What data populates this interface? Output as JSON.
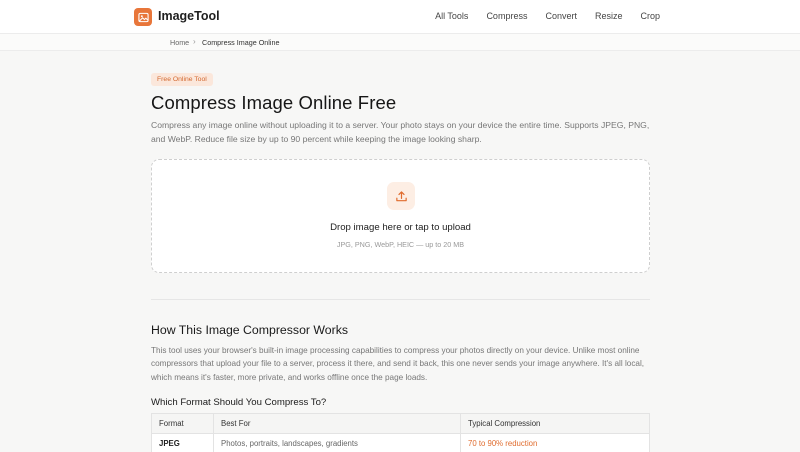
{
  "header": {
    "brand": "ImageTool",
    "nav": [
      "All Tools",
      "Compress",
      "Convert",
      "Resize",
      "Crop"
    ]
  },
  "breadcrumb": {
    "home": "Home",
    "separator": "›",
    "current": "Compress Image Online"
  },
  "hero": {
    "badge": "Free Online Tool",
    "title": "Compress Image Online Free",
    "intro": "Compress any image online without uploading it to a server. Your photo stays on your device the entire time. Supports JPEG, PNG, and WebP. Reduce file size by up to 90 percent while keeping the image looking sharp."
  },
  "upload": {
    "icon": "upload-icon",
    "title": "Drop image here or tap to upload",
    "subtitle": "JPG, PNG, WebP, HEIC — up to 20 MB"
  },
  "how": {
    "heading": "How This Image Compressor Works",
    "body": "This tool uses your browser's built-in image processing capabilities to compress your photos directly on your device. Unlike most online compressors that upload your file to a server, process it there, and send it back, this one never sends your image anywhere. It's all local, which means it's faster, more private, and works offline once the page loads."
  },
  "formats": {
    "heading": "Which Format Should You Compress To?",
    "columns": [
      "Format",
      "Best For",
      "Typical Compression"
    ],
    "rows": [
      {
        "format": "JPEG",
        "best_for": "Photos, portraits, landscapes, gradients",
        "compression": "70 to 90% reduction"
      }
    ]
  },
  "colors": {
    "accent": "#e8763a",
    "badge_bg": "#fbe7db"
  }
}
